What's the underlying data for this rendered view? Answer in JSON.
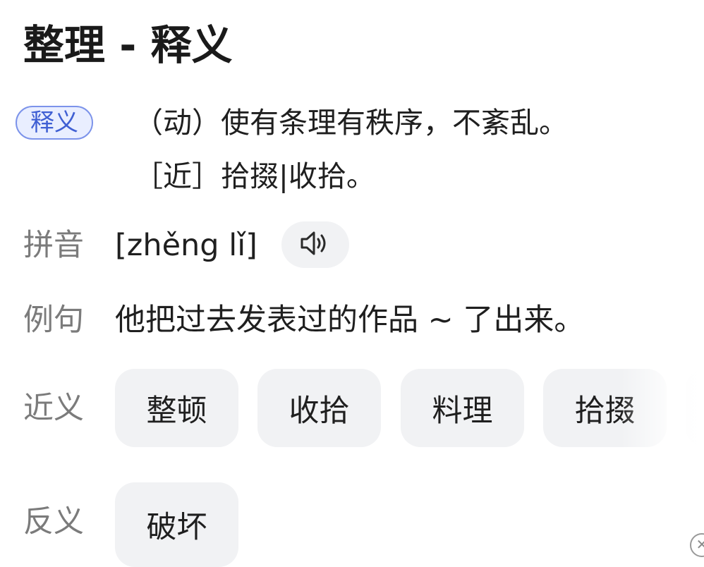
{
  "header": {
    "title": "整理 - 释义"
  },
  "definition": {
    "badge_label": "释义",
    "line1": "（动）使有条理有秩序，不紊乱。",
    "line2": "［近］拾掇|收拾。"
  },
  "pinyin": {
    "label": "拼音",
    "value": "[zhěng lǐ]",
    "speaker_icon": "speaker-icon"
  },
  "example": {
    "label": "例句",
    "value": "他把过去发表过的作品 ~ 了出来。"
  },
  "synonyms": {
    "label": "近义",
    "items": [
      "整顿",
      "收拾",
      "料理",
      "拾掇"
    ]
  },
  "antonyms": {
    "label": "反义",
    "items": [
      "破坏"
    ]
  },
  "colors": {
    "badge_border": "#7c93ea",
    "badge_bg": "#e9eeff",
    "badge_text": "#3f5fd3",
    "chip_bg": "#f1f2f4",
    "label_gray": "#7b7b7b"
  }
}
